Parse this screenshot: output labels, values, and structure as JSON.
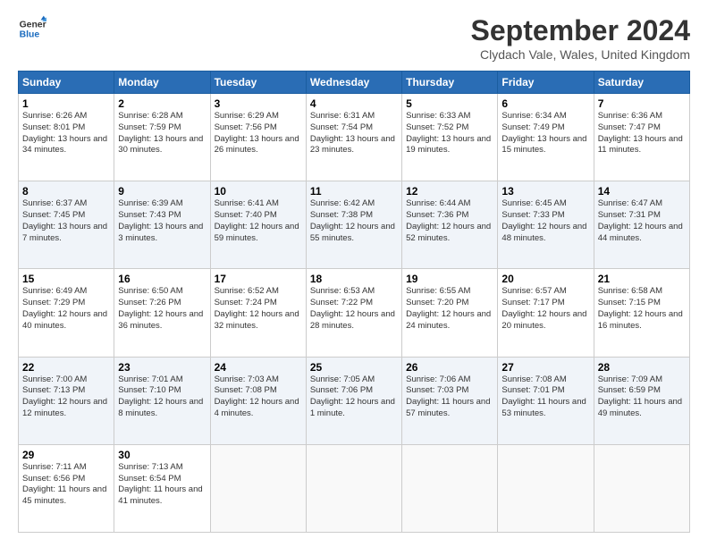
{
  "logo": {
    "line1": "General",
    "line2": "Blue"
  },
  "title": "September 2024",
  "location": "Clydach Vale, Wales, United Kingdom",
  "days_header": [
    "Sunday",
    "Monday",
    "Tuesday",
    "Wednesday",
    "Thursday",
    "Friday",
    "Saturday"
  ],
  "weeks": [
    [
      {
        "day": "1",
        "sunrise": "6:26 AM",
        "sunset": "8:01 PM",
        "daylight": "13 hours and 34 minutes."
      },
      {
        "day": "2",
        "sunrise": "6:28 AM",
        "sunset": "7:59 PM",
        "daylight": "13 hours and 30 minutes."
      },
      {
        "day": "3",
        "sunrise": "6:29 AM",
        "sunset": "7:56 PM",
        "daylight": "13 hours and 26 minutes."
      },
      {
        "day": "4",
        "sunrise": "6:31 AM",
        "sunset": "7:54 PM",
        "daylight": "13 hours and 23 minutes."
      },
      {
        "day": "5",
        "sunrise": "6:33 AM",
        "sunset": "7:52 PM",
        "daylight": "13 hours and 19 minutes."
      },
      {
        "day": "6",
        "sunrise": "6:34 AM",
        "sunset": "7:49 PM",
        "daylight": "13 hours and 15 minutes."
      },
      {
        "day": "7",
        "sunrise": "6:36 AM",
        "sunset": "7:47 PM",
        "daylight": "13 hours and 11 minutes."
      }
    ],
    [
      {
        "day": "8",
        "sunrise": "6:37 AM",
        "sunset": "7:45 PM",
        "daylight": "13 hours and 7 minutes."
      },
      {
        "day": "9",
        "sunrise": "6:39 AM",
        "sunset": "7:43 PM",
        "daylight": "13 hours and 3 minutes."
      },
      {
        "day": "10",
        "sunrise": "6:41 AM",
        "sunset": "7:40 PM",
        "daylight": "12 hours and 59 minutes."
      },
      {
        "day": "11",
        "sunrise": "6:42 AM",
        "sunset": "7:38 PM",
        "daylight": "12 hours and 55 minutes."
      },
      {
        "day": "12",
        "sunrise": "6:44 AM",
        "sunset": "7:36 PM",
        "daylight": "12 hours and 52 minutes."
      },
      {
        "day": "13",
        "sunrise": "6:45 AM",
        "sunset": "7:33 PM",
        "daylight": "12 hours and 48 minutes."
      },
      {
        "day": "14",
        "sunrise": "6:47 AM",
        "sunset": "7:31 PM",
        "daylight": "12 hours and 44 minutes."
      }
    ],
    [
      {
        "day": "15",
        "sunrise": "6:49 AM",
        "sunset": "7:29 PM",
        "daylight": "12 hours and 40 minutes."
      },
      {
        "day": "16",
        "sunrise": "6:50 AM",
        "sunset": "7:26 PM",
        "daylight": "12 hours and 36 minutes."
      },
      {
        "day": "17",
        "sunrise": "6:52 AM",
        "sunset": "7:24 PM",
        "daylight": "12 hours and 32 minutes."
      },
      {
        "day": "18",
        "sunrise": "6:53 AM",
        "sunset": "7:22 PM",
        "daylight": "12 hours and 28 minutes."
      },
      {
        "day": "19",
        "sunrise": "6:55 AM",
        "sunset": "7:20 PM",
        "daylight": "12 hours and 24 minutes."
      },
      {
        "day": "20",
        "sunrise": "6:57 AM",
        "sunset": "7:17 PM",
        "daylight": "12 hours and 20 minutes."
      },
      {
        "day": "21",
        "sunrise": "6:58 AM",
        "sunset": "7:15 PM",
        "daylight": "12 hours and 16 minutes."
      }
    ],
    [
      {
        "day": "22",
        "sunrise": "7:00 AM",
        "sunset": "7:13 PM",
        "daylight": "12 hours and 12 minutes."
      },
      {
        "day": "23",
        "sunrise": "7:01 AM",
        "sunset": "7:10 PM",
        "daylight": "12 hours and 8 minutes."
      },
      {
        "day": "24",
        "sunrise": "7:03 AM",
        "sunset": "7:08 PM",
        "daylight": "12 hours and 4 minutes."
      },
      {
        "day": "25",
        "sunrise": "7:05 AM",
        "sunset": "7:06 PM",
        "daylight": "12 hours and 1 minute."
      },
      {
        "day": "26",
        "sunrise": "7:06 AM",
        "sunset": "7:03 PM",
        "daylight": "11 hours and 57 minutes."
      },
      {
        "day": "27",
        "sunrise": "7:08 AM",
        "sunset": "7:01 PM",
        "daylight": "11 hours and 53 minutes."
      },
      {
        "day": "28",
        "sunrise": "7:09 AM",
        "sunset": "6:59 PM",
        "daylight": "11 hours and 49 minutes."
      }
    ],
    [
      {
        "day": "29",
        "sunrise": "7:11 AM",
        "sunset": "6:56 PM",
        "daylight": "11 hours and 45 minutes."
      },
      {
        "day": "30",
        "sunrise": "7:13 AM",
        "sunset": "6:54 PM",
        "daylight": "11 hours and 41 minutes."
      },
      null,
      null,
      null,
      null,
      null
    ]
  ]
}
